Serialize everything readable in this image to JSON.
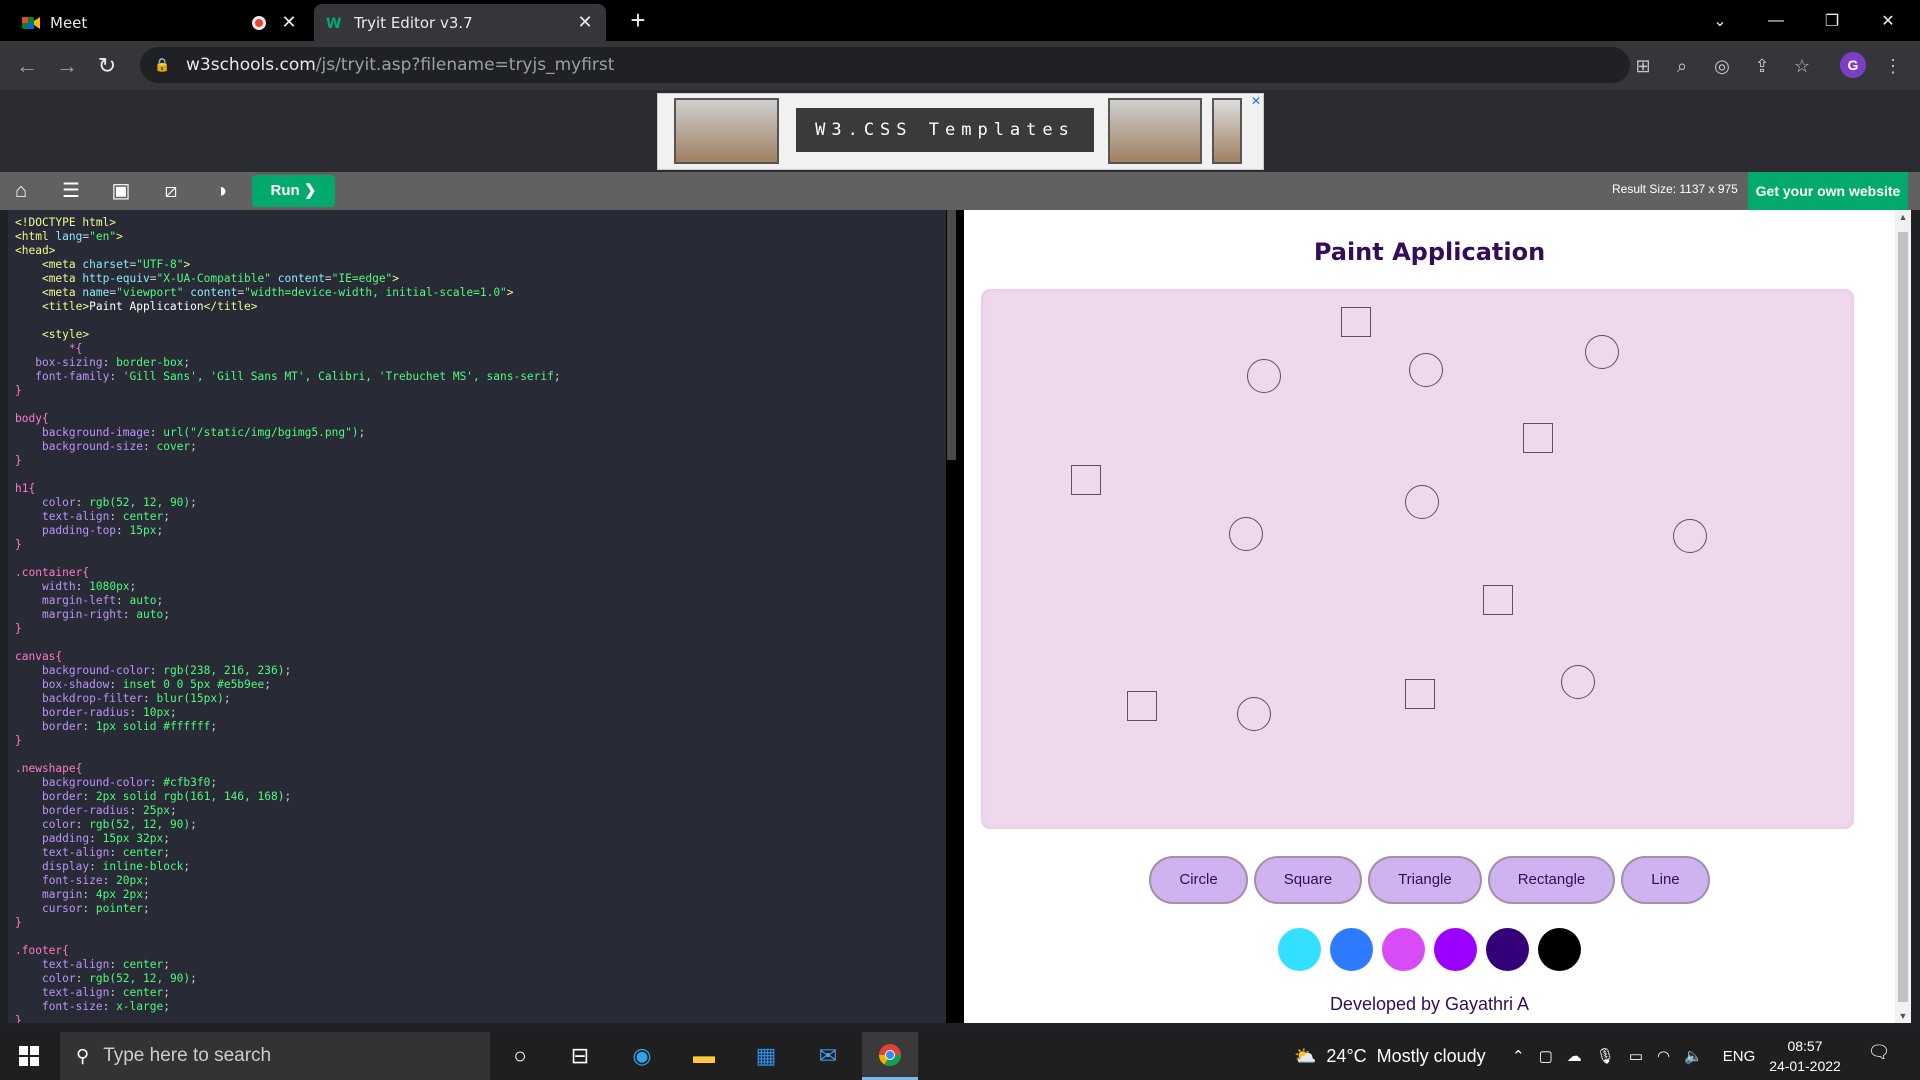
{
  "browser": {
    "tabs": [
      {
        "title": "Meet",
        "active": false
      },
      {
        "title": "Tryit Editor v3.7",
        "active": true
      }
    ],
    "url_host": "w3schools.com",
    "url_path": "/js/tryit.asp?filename=tryjs_myfirst",
    "profile_initial": "G"
  },
  "ad": {
    "banner_text": "W3.CSS Templates"
  },
  "tryit": {
    "run_label": "Run ❯",
    "result_size": "Result Size: 1137 x 975",
    "get_website_label": "Get your own website"
  },
  "result": {
    "title": "Paint Application",
    "shape_buttons": [
      "Circle",
      "Square",
      "Triangle",
      "Rectangle",
      "Line"
    ],
    "colors": [
      "#33e0ff",
      "#2f7bff",
      "#d84cf5",
      "#9b00ff",
      "#33007a",
      "#000000"
    ],
    "footer": "Developed by Gayathri A",
    "shapes": [
      {
        "type": "square"
      },
      {
        "type": "circle"
      },
      {
        "type": "circle"
      },
      {
        "type": "circle"
      },
      {
        "type": "square"
      },
      {
        "type": "square"
      },
      {
        "type": "circle"
      },
      {
        "type": "circle"
      },
      {
        "type": "circle"
      },
      {
        "type": "square"
      },
      {
        "type": "square"
      },
      {
        "type": "circle"
      },
      {
        "type": "square"
      },
      {
        "type": "circle"
      }
    ]
  },
  "taskbar": {
    "search_placeholder": "Type here to search",
    "weather": "24°C  Mostly cloudy",
    "language": "ENG",
    "time": "08:57",
    "date": "24-01-2022"
  }
}
